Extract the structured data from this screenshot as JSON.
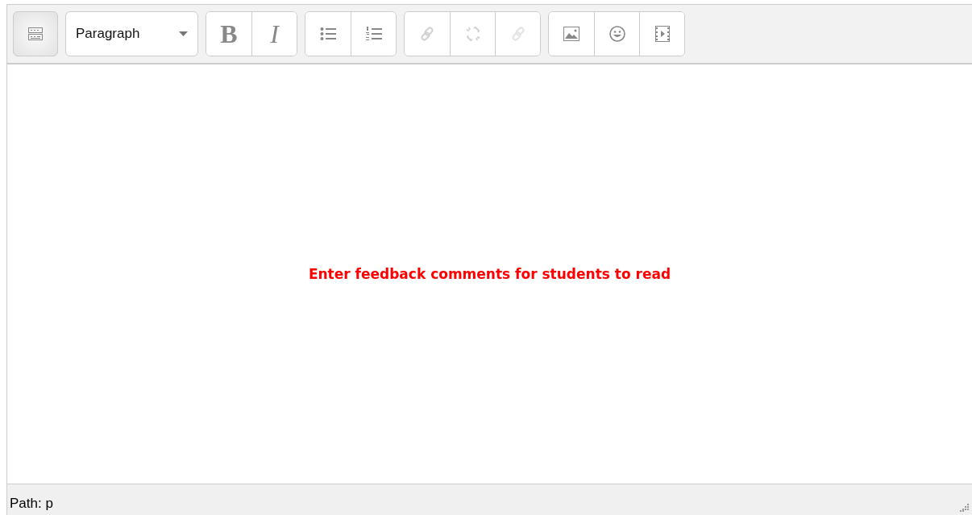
{
  "toolbar": {
    "toggle": {
      "pressed": true
    },
    "format_select": {
      "value": "Paragraph"
    },
    "groups": [
      [
        {
          "kind": "bold",
          "label": "B",
          "disabled": false
        },
        {
          "kind": "italic",
          "label": "I",
          "disabled": false
        }
      ],
      [
        {
          "kind": "bullets",
          "disabled": false
        },
        {
          "kind": "numbers",
          "disabled": false
        }
      ],
      [
        {
          "kind": "link",
          "disabled": true
        },
        {
          "kind": "unlink",
          "disabled": true
        },
        {
          "kind": "anchor",
          "disabled": true
        }
      ],
      [
        {
          "kind": "image",
          "disabled": false
        },
        {
          "kind": "emoticon",
          "disabled": false
        },
        {
          "kind": "media",
          "disabled": false
        }
      ]
    ]
  },
  "editor": {
    "text": "Enter feedback comments for students to read"
  },
  "status_bar": {
    "path": "Path: p"
  }
}
